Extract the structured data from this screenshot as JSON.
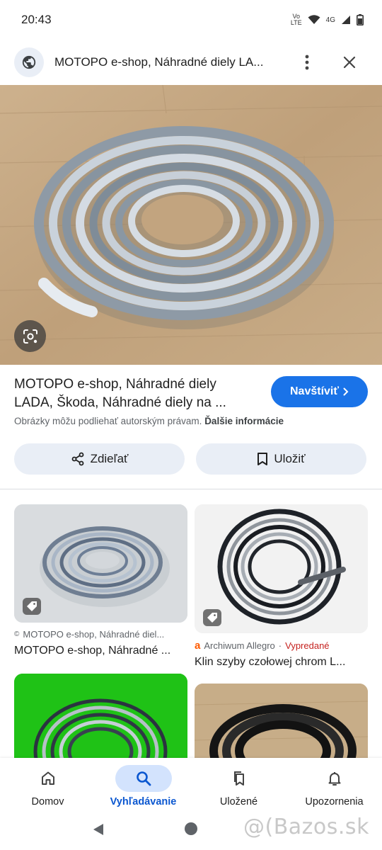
{
  "status": {
    "time": "20:43",
    "volte_top": "Vo",
    "volte_bottom": "LTE",
    "network": "4G"
  },
  "header": {
    "title": "MOTOPO e-shop, Náhradné diely LA...",
    "icons": {
      "site": "globe-icon",
      "menu": "more-vert-icon",
      "close": "close-icon"
    }
  },
  "result": {
    "title": "MOTOPO e-shop, Náhradné diely LADA, Škoda, Náhradné diely na ...",
    "visit_label": "Navštíviť",
    "copyright_text": "Obrázky môžu podliehať autorským právam.",
    "more_info_label": "Ďalšie informácie",
    "share_label": "Zdieľať",
    "save_label": "Uložiť"
  },
  "related": [
    {
      "source": "MOTOPO e-shop, Náhradné diel...",
      "source_icon": "©",
      "title": "MOTOPO e-shop, Náhradné ...",
      "sold": ""
    },
    {
      "source": "Archiwum Allegro",
      "source_icon": "a",
      "sold": "Vypredané",
      "title": "Klin szyby czołowej chrom L..."
    },
    {
      "source": "",
      "title": "",
      "sold": ""
    },
    {
      "source": "",
      "title": "",
      "sold": ""
    }
  ],
  "bottom_nav": [
    {
      "label": "Domov",
      "icon": "home-icon",
      "active": false
    },
    {
      "label": "Vyhľadávanie",
      "icon": "search-icon",
      "active": true
    },
    {
      "label": "Uložené",
      "icon": "bookmarks-icon",
      "active": false
    },
    {
      "label": "Upozornenia",
      "icon": "bell-icon",
      "active": false
    }
  ],
  "watermark": "@(Bazos.sk",
  "colors": {
    "accent": "#1a73e8",
    "active_nav": "#0b57d0",
    "pill_bg": "#e9eef6",
    "sold": "#c5221f"
  }
}
